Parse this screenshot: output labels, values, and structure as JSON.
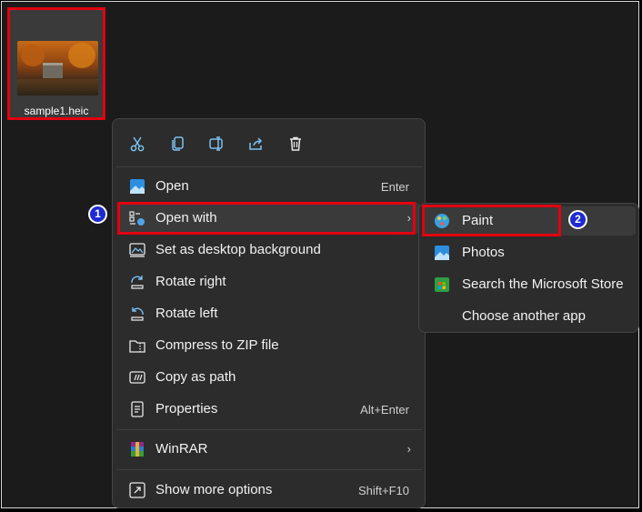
{
  "file": {
    "name": "sample1.heic"
  },
  "toolbar": {
    "cut": "cut-icon",
    "copy": "copy-icon",
    "rename": "rename-icon",
    "share": "share-icon",
    "delete": "delete-icon"
  },
  "menu": {
    "open": {
      "label": "Open",
      "shortcut": "Enter"
    },
    "open_with": {
      "label": "Open with",
      "arrow": "›"
    },
    "desktop_bg": {
      "label": "Set as desktop background"
    },
    "rotate_right": {
      "label": "Rotate right"
    },
    "rotate_left": {
      "label": "Rotate left"
    },
    "compress": {
      "label": "Compress to ZIP file"
    },
    "copy_path": {
      "label": "Copy as path"
    },
    "properties": {
      "label": "Properties",
      "shortcut": "Alt+Enter"
    },
    "winrar": {
      "label": "WinRAR",
      "arrow": "›"
    },
    "more": {
      "label": "Show more options",
      "shortcut": "Shift+F10"
    }
  },
  "submenu": {
    "paint": "Paint",
    "photos": "Photos",
    "store": "Search the Microsoft Store",
    "choose": "Choose another app"
  },
  "badges": {
    "one": "1",
    "two": "2"
  },
  "colors": {
    "highlight_box": "#e3000f",
    "badge": "#1f2bd1",
    "accent": "#4ea4e8"
  }
}
